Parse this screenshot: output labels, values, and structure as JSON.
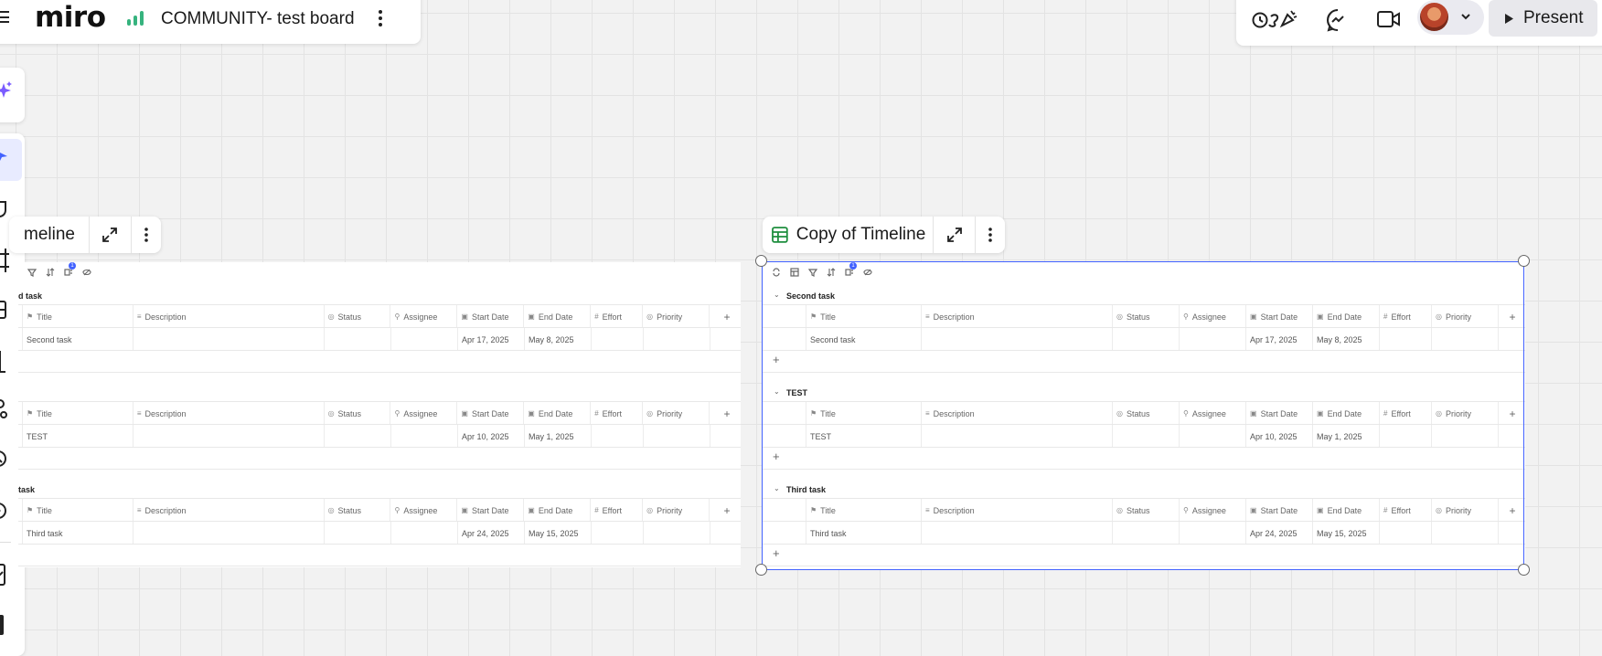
{
  "board": {
    "logo": "miro",
    "title": "COMMUNITY- test board"
  },
  "topbar": {
    "present_label": "Present"
  },
  "tables": [
    {
      "title": "meline",
      "groups": [
        {
          "name": "d task",
          "rows": [
            {
              "title": "Second task",
              "start": "Apr 17, 2025",
              "end": "May 8, 2025"
            }
          ]
        },
        {
          "name": "",
          "rows": [
            {
              "title": "TEST",
              "start": "Apr 10, 2025",
              "end": "May 1, 2025"
            }
          ]
        },
        {
          "name": "task",
          "rows": [
            {
              "title": "Third task",
              "start": "Apr 24, 2025",
              "end": "May 15, 2025"
            }
          ]
        }
      ]
    },
    {
      "title": "Copy of Timeline",
      "groups": [
        {
          "name": "Second task",
          "rows": [
            {
              "title": "Second task",
              "start": "Apr 17, 2025",
              "end": "May 8, 2025"
            }
          ]
        },
        {
          "name": "TEST",
          "rows": [
            {
              "title": "TEST",
              "start": "Apr 10, 2025",
              "end": "May 1, 2025"
            }
          ]
        },
        {
          "name": "Third task",
          "rows": [
            {
              "title": "Third task",
              "start": "Apr 24, 2025",
              "end": "May 15, 2025"
            }
          ]
        }
      ]
    }
  ],
  "columns": {
    "title": "Title",
    "description": "Description",
    "status": "Status",
    "assignee": "Assignee",
    "start_date": "Start Date",
    "end_date": "End Date",
    "effort": "Effort",
    "priority": "Priority"
  },
  "badge_count": "1",
  "colors": {
    "accent": "#4262ff",
    "brand_green": "#36b37e",
    "table_icon_green": "#1e8e3e"
  }
}
